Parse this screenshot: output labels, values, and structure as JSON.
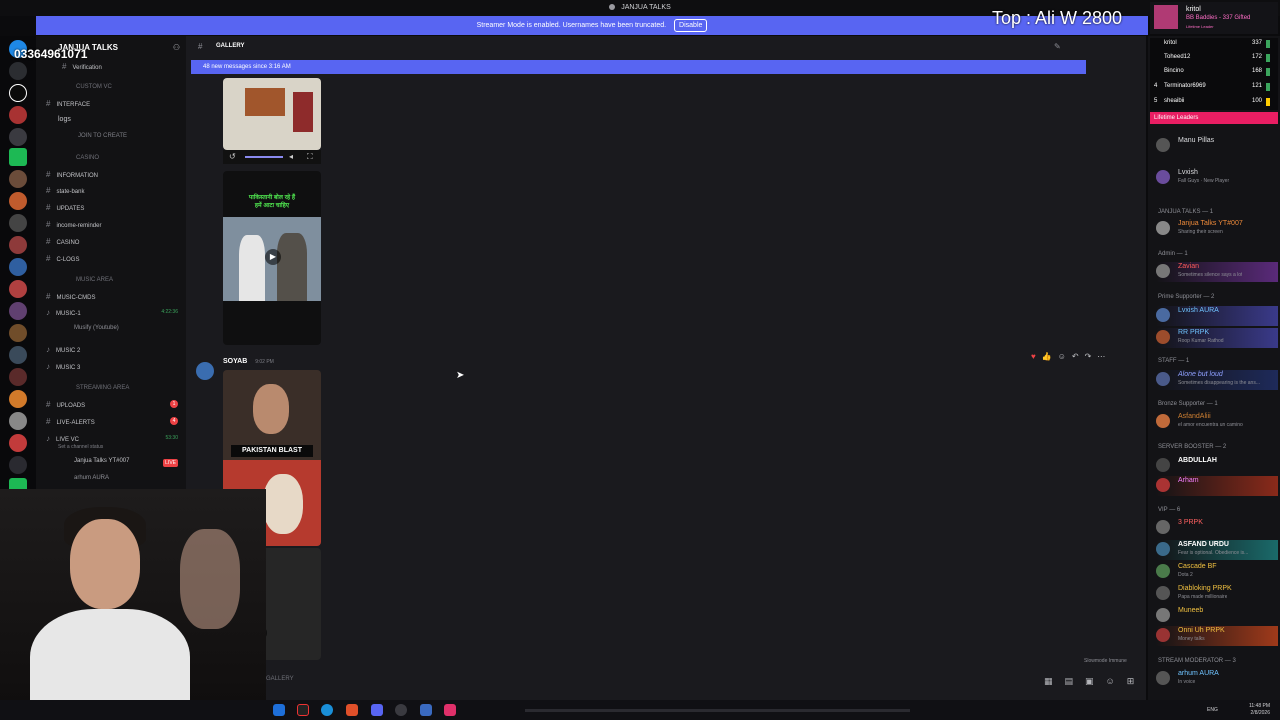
{
  "window": {
    "title": "JANJUA TALKS"
  },
  "streamer_bar": {
    "text": "Streamer Mode is enabled. Usernames have been truncated.",
    "button": "Disable"
  },
  "overlay": {
    "phone": "03364961071",
    "top_text": "Top : Ali W 2800"
  },
  "gift_alert": {
    "name": "kritol",
    "line2": "BB Baddies - 337 Gifted",
    "line3": "Lifetime Leader"
  },
  "leaderboard": {
    "rows": [
      {
        "rank": "",
        "name": "kritol",
        "points": "337"
      },
      {
        "rank": "",
        "name": "Toheed12",
        "points": "172"
      },
      {
        "rank": "",
        "name": "Bincino",
        "points": "168"
      },
      {
        "rank": "4",
        "name": "Terminator6969",
        "points": "121"
      },
      {
        "rank": "5",
        "name": "sheaibii",
        "points": "100"
      }
    ],
    "title": "Lifetime Leaders"
  },
  "sidebar": {
    "server_name": "JANJUA TALKS",
    "items": [
      {
        "type": "channel",
        "label": "Verification"
      },
      {
        "type": "category",
        "label": "CUSTOM VC"
      },
      {
        "type": "channel",
        "label": "INTERFACE"
      },
      {
        "type": "channel",
        "label": "logs"
      },
      {
        "type": "channel",
        "label": "JOIN TO CREATE"
      },
      {
        "type": "category",
        "label": "CASINO"
      },
      {
        "type": "channel",
        "label": "INFORMATION"
      },
      {
        "type": "channel",
        "label": "state-bank"
      },
      {
        "type": "channel",
        "label": "UPDATES"
      },
      {
        "type": "channel",
        "label": "income-reminder"
      },
      {
        "type": "channel",
        "label": "CASINO"
      },
      {
        "type": "channel",
        "label": "C-LOGS"
      },
      {
        "type": "category",
        "label": "MUSIC AREA"
      },
      {
        "type": "channel",
        "label": "MUSIC-CMDS"
      },
      {
        "type": "channel",
        "label": "MUSIC-1",
        "time": "4:22:36"
      },
      {
        "type": "channel",
        "label": "Musify (Youtube)"
      },
      {
        "type": "channel",
        "label": "MUSIC 2"
      },
      {
        "type": "channel",
        "label": "MUSIC 3"
      },
      {
        "type": "category",
        "label": "STREAMING AREA"
      },
      {
        "type": "channel",
        "label": "UPLOADS",
        "badge": "1"
      },
      {
        "type": "channel",
        "label": "LIVE-ALERTS",
        "badge": "4"
      },
      {
        "type": "channel",
        "label": "LIVE VC",
        "time": "53:30"
      },
      {
        "type": "channel",
        "label": "Set a channel status"
      },
      {
        "type": "channel",
        "label": "Janjua Talks YT#007",
        "live": "LIVE"
      },
      {
        "type": "channel",
        "label": "arhum AURA"
      }
    ]
  },
  "chat": {
    "channel": "GALLERY",
    "new_messages": "48 new messages since 3:16 AM",
    "message": {
      "author": "SOYAB",
      "timestamp": "9:02 PM",
      "thumb_text": "PAKISTAN BLAST"
    },
    "video_text": "पाकिस्तानी बोल रहे हैं\nहमें आटा चाहिए",
    "composer_placeholder": "GALLERY",
    "slowmode": "Slowmode Immune"
  },
  "members": {
    "rows": [
      {
        "kind": "member",
        "name": "Manu Pillas",
        "sub": ""
      },
      {
        "kind": "member",
        "name": "Lvxish",
        "sub": "Fall Guys · New Player"
      },
      {
        "kind": "group",
        "label": "JANJUA TALKS — 1"
      },
      {
        "kind": "member",
        "name": "Janjua Talks YT#007",
        "sub": "Sharing their screen"
      },
      {
        "kind": "group",
        "label": "Admin — 1"
      },
      {
        "kind": "member",
        "name": "Zavian",
        "sub": "Sometimes silence says a lot"
      },
      {
        "kind": "group",
        "label": "Prime Supporter — 2"
      },
      {
        "kind": "member",
        "name": "Lvxish AURA",
        "sub": ""
      },
      {
        "kind": "member",
        "name": "RR PRPK",
        "sub": "Roop Kumar Rathod"
      },
      {
        "kind": "group",
        "label": "STAFF — 1"
      },
      {
        "kind": "member",
        "name": "Alone but loud",
        "sub": "Sometimes disappearing is the ans..."
      },
      {
        "kind": "group",
        "label": "Bronze Supporter — 1"
      },
      {
        "kind": "member",
        "name": "AsfandAliii",
        "sub": "el amor encuentra un camino"
      },
      {
        "kind": "group",
        "label": "SERVER BOOSTER — 2"
      },
      {
        "kind": "member",
        "name": "ABDULLAH",
        "sub": ""
      },
      {
        "kind": "member",
        "name": "Arham",
        "sub": ""
      },
      {
        "kind": "group",
        "label": "VIP — 6"
      },
      {
        "kind": "member",
        "name": "3 PRPK",
        "sub": ""
      },
      {
        "kind": "member",
        "name": "ASFAND URDU",
        "sub": "Fear is optional. Obedience is..."
      },
      {
        "kind": "member",
        "name": "Cascade BF",
        "sub": "Dota 2"
      },
      {
        "kind": "member",
        "name": "Diabloking PRPK",
        "sub": "Papa made millionaire"
      },
      {
        "kind": "member",
        "name": "Muneeb",
        "sub": ""
      },
      {
        "kind": "member",
        "name": "Onni Uh PRPK",
        "sub": "Money talks"
      },
      {
        "kind": "group",
        "label": "STREAM MODERATOR — 3"
      },
      {
        "kind": "member",
        "name": "arhum AURA",
        "sub": "In voice"
      }
    ]
  },
  "taskbar": {
    "lang": "ENG",
    "time": "11:48 PM",
    "date": "2/8/2026"
  },
  "colors": {
    "blurple": "#5865f2",
    "red": "#ed4245",
    "green": "#3ba55d",
    "pink": "#e91e63"
  }
}
